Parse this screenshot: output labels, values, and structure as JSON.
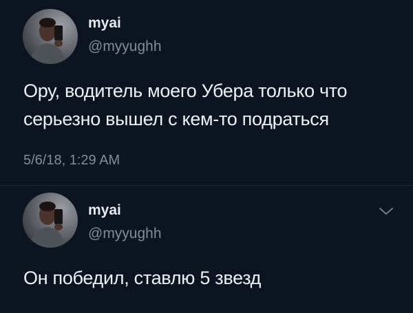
{
  "tweets": [
    {
      "author": {
        "display_name": "myai",
        "handle": "@myyughh"
      },
      "text": "Ору, водитель моего Убера только что\nсерьезно вышел с кем-то подраться",
      "timestamp": "5/6/18, 1:29 AM"
    },
    {
      "author": {
        "display_name": "myai",
        "handle": "@myyughh"
      },
      "text": "Он победил, ставлю 5 звезд",
      "menu_icon": "chevron-down-icon"
    }
  ],
  "colors": {
    "background": "#0c1421",
    "primary_text": "#eef2f5",
    "secondary_text": "#7e8d9c"
  }
}
